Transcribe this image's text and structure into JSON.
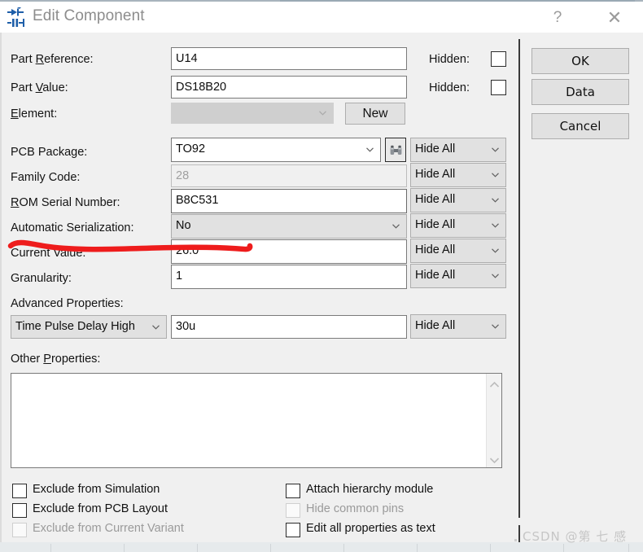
{
  "window": {
    "title": "Edit Component",
    "icon": "component-diode-icon",
    "help_label": "?",
    "close_label": "✕"
  },
  "form": {
    "rows": [
      {
        "label_pre": "Part ",
        "label_mnemonic": "R",
        "label_post": "eference:",
        "value": "U14",
        "control": "text"
      },
      {
        "label_pre": "Part ",
        "label_mnemonic": "V",
        "label_post": "alue:",
        "value": "DS18B20",
        "control": "text"
      },
      {
        "label_pre": "",
        "label_mnemonic": "E",
        "label_post": "lement:",
        "value": "",
        "control": "combo-disabled"
      },
      {
        "label_pre": "PCB Package:",
        "label_mnemonic": "",
        "label_post": "",
        "value": "TO92",
        "control": "combo-white"
      },
      {
        "label_pre": "Family Code:",
        "label_mnemonic": "",
        "label_post": "",
        "value": "28",
        "control": "text-readonly"
      },
      {
        "label_pre": "",
        "label_mnemonic": "R",
        "label_post": "OM Serial Number:",
        "value": "B8C531",
        "control": "text"
      },
      {
        "label_pre": "Automatic Serialization:",
        "label_mnemonic": "",
        "label_post": "",
        "value": "No",
        "control": "combo"
      },
      {
        "label_pre": "Current Value:",
        "label_mnemonic": "",
        "label_post": "",
        "value": "26.0",
        "control": "text"
      },
      {
        "label_pre": "Granularity:",
        "label_mnemonic": "",
        "label_post": "",
        "value": "1",
        "control": "text"
      }
    ],
    "hidden_label": "Hidden:",
    "new_button": "New",
    "search_icon": "binoculars-icon",
    "hide_all_label": "Hide All",
    "hide_all_count": 7,
    "advanced_properties_label": "Advanced Properties:",
    "advanced_property_name": "Time Pulse Delay High",
    "advanced_property_value": "30u",
    "other_properties_pre": "Other ",
    "other_properties_mnemonic": "P",
    "other_properties_post": "roperties:",
    "other_properties_value": ""
  },
  "buttons": {
    "ok": "OK",
    "data": "Data",
    "cancel": "Cancel"
  },
  "checkboxes": {
    "left": [
      {
        "label": "Exclude from Simulation",
        "checked": false,
        "disabled": false
      },
      {
        "label": "Exclude from PCB Layout",
        "checked": false,
        "disabled": false
      },
      {
        "label": "Exclude from Current Variant",
        "checked": false,
        "disabled": true
      }
    ],
    "right": [
      {
        "label": "Attach hierarchy module",
        "checked": false,
        "disabled": false
      },
      {
        "label": "Hide common pins",
        "checked": false,
        "disabled": true
      },
      {
        "label": "Edit all properties as text",
        "checked": false,
        "disabled": false
      }
    ]
  },
  "watermark": "CSDN @第 七 感",
  "colors": {
    "dialog_bg": "#f0f0f0",
    "titlebar_bg": "#ffffff",
    "title_text": "#8d8d8d",
    "field_border": "#7a7a7a",
    "combo_bg": "#e1e1e1",
    "annotation_red": "#ee1c1c",
    "accent_blue": "#1f5fa9"
  }
}
